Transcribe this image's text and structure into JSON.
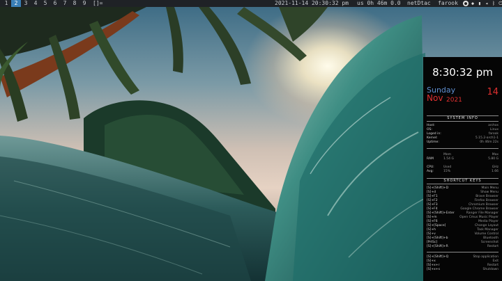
{
  "topbar": {
    "workspaces": [
      "1",
      "2",
      "3",
      "4",
      "5",
      "6",
      "7",
      "8",
      "9"
    ],
    "active_workspace": "2",
    "layout_indicator": "[]=",
    "datetime": "2021-11-14 20:30:32 pm",
    "uptime": "us 0h 46m 0.0",
    "network": "netDtac",
    "user": "farook"
  },
  "conky": {
    "clock": "8:30:32 pm",
    "day": "Sunday",
    "month": "Nov",
    "year": "2021",
    "day_number": "14",
    "system_info_title": "SYSTEM INFO",
    "system_info": [
      {
        "k": "Host:",
        "v": "archos"
      },
      {
        "k": "OS:",
        "v": "Linux"
      },
      {
        "k": "Loged in:",
        "v": "farook"
      },
      {
        "k": "Kernel:",
        "v": "5.15.2-arch1-1"
      },
      {
        "k": "Uptime:",
        "v": "0h 46m 22s"
      }
    ],
    "mem_table": [
      {
        "c0": "",
        "c1": "Mem",
        "c2": "Max"
      },
      {
        "c0": "RAM",
        "c1": "1.54 G",
        "c2": "5.80 G"
      }
    ],
    "cpu_table": [
      {
        "c0": "CPU:",
        "c1": "Used",
        "c2": "GHz"
      },
      {
        "c0": "Avg:",
        "c1": "15%",
        "c2": "1.66"
      }
    ],
    "shortcut_title": "SHORTCUT KEYS",
    "shortcuts": [
      {
        "k": "[S]+[Shift]+D",
        "v": "Main Menu"
      },
      {
        "k": "[S]+d",
        "v": "Show Menu"
      },
      {
        "k": "[S]+F1",
        "v": "Brave Browser"
      },
      {
        "k": "[S]+F2",
        "v": "Firefox Browser"
      },
      {
        "k": "[S]+F3",
        "v": "Chromium Browser"
      },
      {
        "k": "[S]+F4",
        "v": "Google Chrome Browser"
      },
      {
        "k": "[S]+[Shift]+Enter",
        "v": "Ranger File Manager"
      },
      {
        "k": "[S]+m",
        "v": "Open Cmus Music Player"
      },
      {
        "k": "[S]+F6",
        "v": "Media Player"
      },
      {
        "k": "[S]+[Space]",
        "v": "Change Layout"
      },
      {
        "k": "[S]+h",
        "v": "Task Manager"
      },
      {
        "k": "[S]+v",
        "v": "Volume Control"
      },
      {
        "k": "[S]+[Shift]+b",
        "v": "Bluetooth"
      },
      {
        "k": "[PrtSc]",
        "v": "Screenshot"
      },
      {
        "k": "[S]+[Shift]+R",
        "v": "Restart"
      }
    ],
    "power_keys": [
      {
        "k": "[S]+[Shift]+Q",
        "v": "Stop application"
      },
      {
        "k": "[S]+x",
        "v": "Exit"
      },
      {
        "k": "[S]+x+r",
        "v": "Restart"
      },
      {
        "k": "[S]+x+s",
        "v": "Shutdown"
      }
    ]
  }
}
